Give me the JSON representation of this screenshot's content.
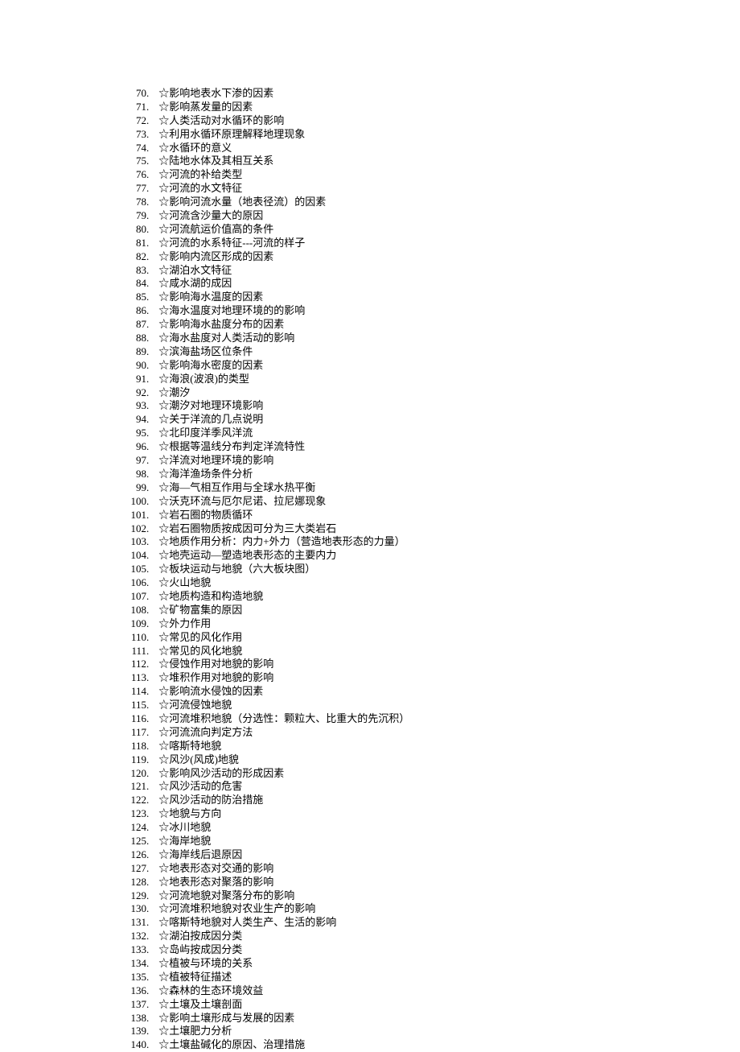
{
  "items": [
    {
      "n": "70",
      "t": "☆影响地表水下渗的因素"
    },
    {
      "n": "71",
      "t": "☆影响蒸发量的因素"
    },
    {
      "n": "72",
      "t": "☆人类活动对水循环的影响"
    },
    {
      "n": "73",
      "t": "☆利用水循环原理解释地理现象"
    },
    {
      "n": "74",
      "t": "☆水循环的意义"
    },
    {
      "n": "75",
      "t": "☆陆地水体及其相互关系"
    },
    {
      "n": "76",
      "t": "☆河流的补给类型"
    },
    {
      "n": "77",
      "t": "☆河流的水文特征"
    },
    {
      "n": "78",
      "t": "☆影响河流水量（地表径流）的因素"
    },
    {
      "n": "79",
      "t": "☆河流含沙量大的原因"
    },
    {
      "n": "80",
      "t": "☆河流航运价值高的条件"
    },
    {
      "n": "81",
      "t": "☆河流的水系特征---河流的样子"
    },
    {
      "n": "82",
      "t": "☆影响内流区形成的因素"
    },
    {
      "n": "83",
      "t": "☆湖泊水文特征"
    },
    {
      "n": "84",
      "t": "☆咸水湖的成因"
    },
    {
      "n": "85",
      "t": "☆影响海水温度的因素"
    },
    {
      "n": "86",
      "t": "☆海水温度对地理环境的的影响"
    },
    {
      "n": "87",
      "t": "☆影响海水盐度分布的因素"
    },
    {
      "n": "88",
      "t": "☆海水盐度对人类活动的影响"
    },
    {
      "n": "89",
      "t": "☆滨海盐场区位条件"
    },
    {
      "n": "90",
      "t": "☆影响海水密度的因素"
    },
    {
      "n": "91",
      "t": "☆海浪(波浪)的类型"
    },
    {
      "n": "92",
      "t": "☆潮汐"
    },
    {
      "n": "93",
      "t": "☆潮汐对地理环境影响"
    },
    {
      "n": "94",
      "t": "☆关于洋流的几点说明"
    },
    {
      "n": "95",
      "t": "☆北印度洋季风洋流"
    },
    {
      "n": "96",
      "t": "☆根据等温线分布判定洋流特性"
    },
    {
      "n": "97",
      "t": "☆洋流对地理环境的影响"
    },
    {
      "n": "98",
      "t": "☆海洋渔场条件分析"
    },
    {
      "n": "99",
      "t": "☆海—气相互作用与全球水热平衡"
    },
    {
      "n": "100",
      "t": "☆沃克环流与厄尔尼诺、拉尼娜现象"
    },
    {
      "n": "101",
      "t": "☆岩石圈的物质循环"
    },
    {
      "n": "102",
      "t": "☆岩石圈物质按成因可分为三大类岩石"
    },
    {
      "n": "103",
      "t": "☆地质作用分析：内力+外力（营造地表形态的力量）"
    },
    {
      "n": "104",
      "t": "☆地壳运动—塑造地表形态的主要内力"
    },
    {
      "n": "105",
      "t": "☆板块运动与地貌（六大板块图）"
    },
    {
      "n": "106",
      "t": "☆火山地貌"
    },
    {
      "n": "107",
      "t": "☆地质构造和构造地貌"
    },
    {
      "n": "108",
      "t": "☆矿物富集的原因"
    },
    {
      "n": "109",
      "t": "☆外力作用"
    },
    {
      "n": "110",
      "t": "☆常见的风化作用"
    },
    {
      "n": "111",
      "t": "☆常见的风化地貌"
    },
    {
      "n": "112",
      "t": "☆侵蚀作用对地貌的影响"
    },
    {
      "n": "113",
      "t": "☆堆积作用对地貌的影响"
    },
    {
      "n": "114",
      "t": "☆影响流水侵蚀的因素"
    },
    {
      "n": "115",
      "t": "☆河流侵蚀地貌"
    },
    {
      "n": "116",
      "t": "☆河流堆积地貌（分选性：颗粒大、比重大的先沉积）"
    },
    {
      "n": "117",
      "t": "☆河流流向判定方法"
    },
    {
      "n": "118",
      "t": "☆喀斯特地貌"
    },
    {
      "n": "119",
      "t": "☆风沙(风成)地貌"
    },
    {
      "n": "120",
      "t": "☆影响风沙活动的形成因素"
    },
    {
      "n": "121",
      "t": "☆风沙活动的危害"
    },
    {
      "n": "122",
      "t": "☆风沙活动的防治措施"
    },
    {
      "n": "123",
      "t": "☆地貌与方向"
    },
    {
      "n": "124",
      "t": "☆冰川地貌"
    },
    {
      "n": "125",
      "t": "☆海岸地貌"
    },
    {
      "n": "126",
      "t": "☆海岸线后退原因"
    },
    {
      "n": "127",
      "t": "☆地表形态对交通的影响"
    },
    {
      "n": "128",
      "t": "☆地表形态对聚落的影响"
    },
    {
      "n": "129",
      "t": "☆河流地貌对聚落分布的影响"
    },
    {
      "n": "130",
      "t": "☆河流堆积地貌对农业生产的影响"
    },
    {
      "n": "131",
      "t": "☆喀斯特地貌对人类生产、生活的影响"
    },
    {
      "n": "132",
      "t": "☆湖泊按成因分类"
    },
    {
      "n": "133",
      "t": "☆岛屿按成因分类"
    },
    {
      "n": "134",
      "t": "☆植被与环境的关系"
    },
    {
      "n": "135",
      "t": "☆植被特征描述"
    },
    {
      "n": "136",
      "t": "☆森林的生态环境效益"
    },
    {
      "n": "137",
      "t": "☆土壤及土壤剖面"
    },
    {
      "n": "138",
      "t": "☆影响土壤形成与发展的因素"
    },
    {
      "n": "139",
      "t": "☆土壤肥力分析"
    },
    {
      "n": "140",
      "t": "☆土壤盐碱化的原因、治理措施"
    }
  ]
}
